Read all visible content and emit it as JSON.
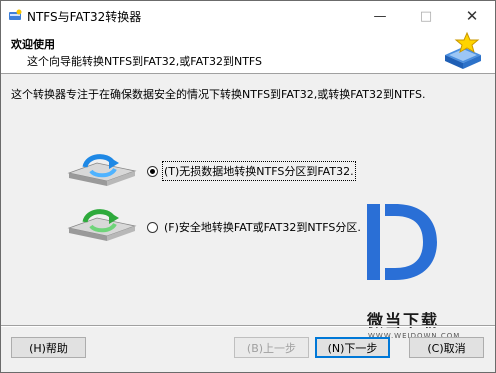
{
  "window": {
    "title": "NTFS与FAT32转换器",
    "controls": {
      "minimize": "—",
      "maximize": "□",
      "close": "✕"
    }
  },
  "header": {
    "title": "欢迎使用",
    "subtitle": "这个向导能转换NTFS到FAT32,或FAT32到NTFS"
  },
  "intro": "这个转换器专注于在确保数据安全的情况下转换NTFS到FAT32,或转换FAT32到NTFS.",
  "options": [
    {
      "label": "(T)无损数据地转换NTFS分区到FAT32.",
      "selected": true,
      "icon": "disk-blue-arrow-icon"
    },
    {
      "label": "(F)安全地转换FAT或FAT32到NTFS分区.",
      "selected": false,
      "icon": "disk-green-arrow-icon"
    }
  ],
  "watermark": {
    "text": "微当下载",
    "url": "WWW.WEIDOWN.COM"
  },
  "buttons": {
    "help": "(H)帮助",
    "back": "(B)上一步",
    "next": "(N)下一步",
    "cancel": "(C)取消"
  },
  "colors": {
    "accent": "#0078d7",
    "brand_blue": "#2a6fd6"
  }
}
